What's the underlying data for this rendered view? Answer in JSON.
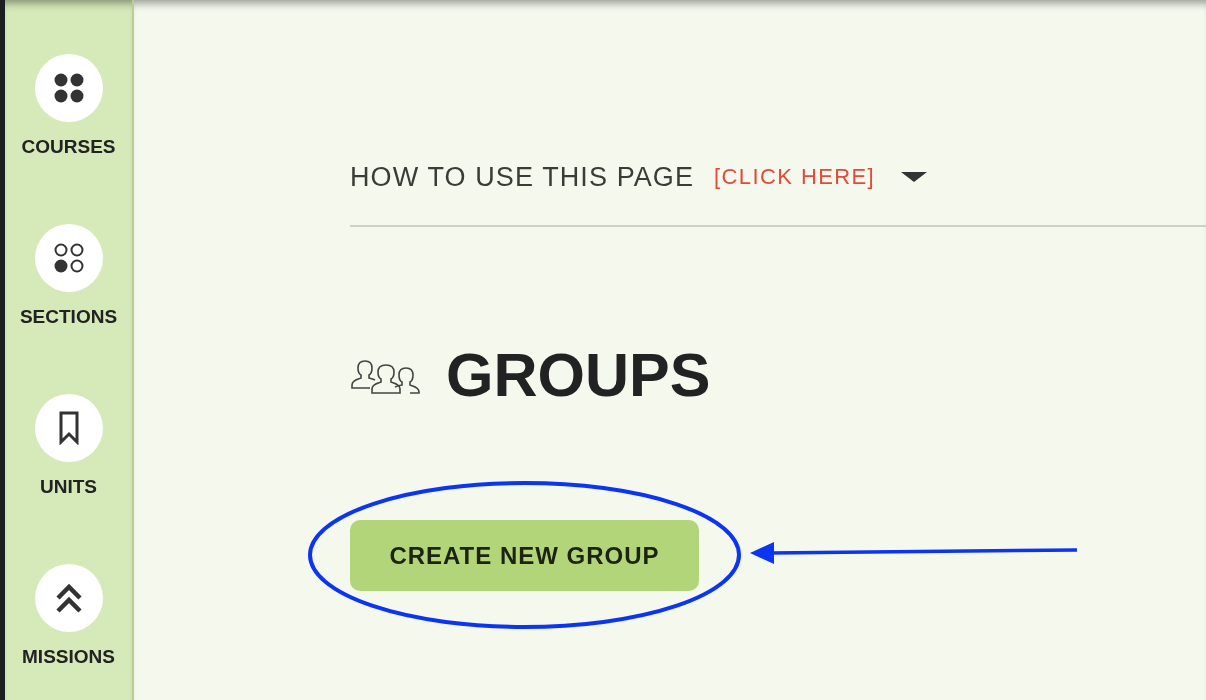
{
  "sidebar": {
    "items": [
      {
        "label": "COURSES"
      },
      {
        "label": "SECTIONS"
      },
      {
        "label": "UNITS"
      },
      {
        "label": "MISSIONS"
      }
    ]
  },
  "help_bar": {
    "title": "HOW TO USE THIS PAGE",
    "link": "[CLICK HERE]",
    "expanded": false
  },
  "page": {
    "title": "GROUPS",
    "button": {
      "label": "CREATE NEW GROUP",
      "highlighted": true
    }
  }
}
